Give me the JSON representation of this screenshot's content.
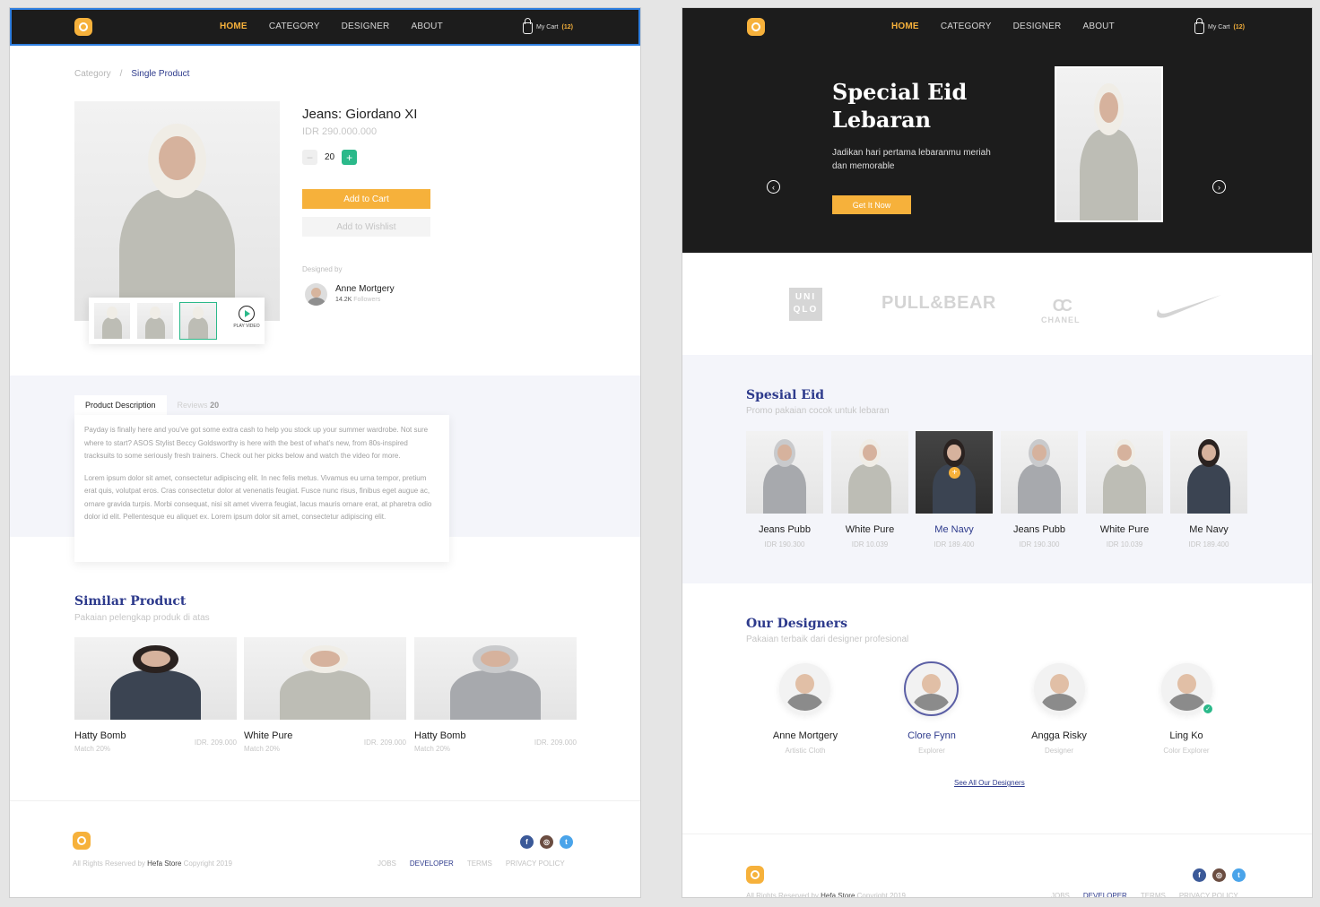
{
  "nav": {
    "menu": [
      "HOME",
      "CATEGORY",
      "DESIGNER",
      "ABOUT"
    ],
    "cart_label": "My Cart",
    "cart_count": "(12)"
  },
  "product_page": {
    "breadcrumb": [
      "Category",
      "/",
      "Single Product"
    ],
    "product": {
      "name": "Jeans: Giordano XI",
      "price": "IDR 290.000.000",
      "quantity": "20",
      "add_to_cart": "Add to Cart",
      "add_to_wishlist": "Add to Wishlist",
      "play_video": "PLAY VIDEO"
    },
    "designer": {
      "heading": "Designed by",
      "name": "Anne Mortgery",
      "followers_count": "14.2K",
      "followers_label": "Followers"
    },
    "tabs": {
      "description": "Product Description",
      "reviews": "Reviews",
      "reviews_count": "20"
    },
    "description": [
      "Payday is finally here and you've got some extra cash to help you  stock up your summer wardrobe. Not sure where to start? ASOS Stylist Beccy Goldsworthy is here with the best of what's new, from 80s-inspired tracksuits to some seriously fresh trainers. Check out her picks below and watch the video for more.",
      "Lorem ipsum dolor sit amet, consectetur adipiscing elit. In nec felis metus. Vivamus eu urna tempor, pretium erat quis, volutpat eros. Cras consectetur dolor at venenatis feugiat. Fusce nunc risus, finibus eget augue ac, ornare gravida turpis. Morbi consequat, nisi sit amet viverra feugiat, lacus mauris ornare erat, at pharetra odio dolor id elit. Pellentesque eu aliquet ex. Lorem ipsum dolor sit amet, consectetur adipiscing elit."
    ],
    "similar": {
      "title": "Similar Product",
      "subtitle": "Pakaian pelengkap produk di atas",
      "items": [
        {
          "name": "Hatty Bomb",
          "match": "Match 20%",
          "price": "IDR. 209.000"
        },
        {
          "name": "White Pure",
          "match": "Match 20%",
          "price": "IDR. 209.000"
        },
        {
          "name": "Hatty Bomb",
          "match": "Match 20%",
          "price": "IDR. 209.000"
        }
      ]
    }
  },
  "home_page": {
    "hero": {
      "title": "Special Eid Lebaran",
      "text": "Jadikan hari pertama lebaranmu meriah dan memorable",
      "button": "Get It Now"
    },
    "brands": {
      "uniqlo": "UNI QLO",
      "pullbear": "PULL&BEAR",
      "chanel": "CHANEL",
      "chanel_mark": "CC"
    },
    "spesial_eid": {
      "title": "Spesial Eid",
      "subtitle": "Promo pakaian cocok untuk lebaran",
      "items": [
        {
          "name": "Jeans Pubb",
          "price": "IDR 190.300"
        },
        {
          "name": "White Pure",
          "price": "IDR 10.039"
        },
        {
          "name": "Me Navy",
          "price": "IDR 189.400"
        },
        {
          "name": "Jeans Pubb",
          "price": "IDR 190.300"
        },
        {
          "name": "White Pure",
          "price": "IDR 10.039"
        },
        {
          "name": "Me Navy",
          "price": "IDR 189.400"
        }
      ]
    },
    "designers": {
      "title": "Our Designers",
      "subtitle": "Pakaian terbaik dari designer profesional",
      "items": [
        {
          "name": "Anne Mortgery",
          "role": "Artistic Cloth"
        },
        {
          "name": "Clore Fynn",
          "role": "Explorer"
        },
        {
          "name": "Angga Risky",
          "role": "Designer"
        },
        {
          "name": "Ling Ko",
          "role": "Color Explorer"
        }
      ],
      "see_all": "See All Our Designers"
    }
  },
  "footer": {
    "copyright_prefix": "All Rights Reserved by",
    "store": "Hefa Store",
    "copyright_suffix": "Copyright 2019",
    "links": [
      "JOBS",
      "DEVELOPER",
      "TERMS",
      "PRIVACY POLICY"
    ],
    "social": [
      "f",
      "◎",
      "t"
    ]
  },
  "colors": {
    "accent": "#f6b13b",
    "brand_blue": "#2d3a8c",
    "success": "#2bb98a",
    "nav_bg": "#1c1c1c"
  }
}
